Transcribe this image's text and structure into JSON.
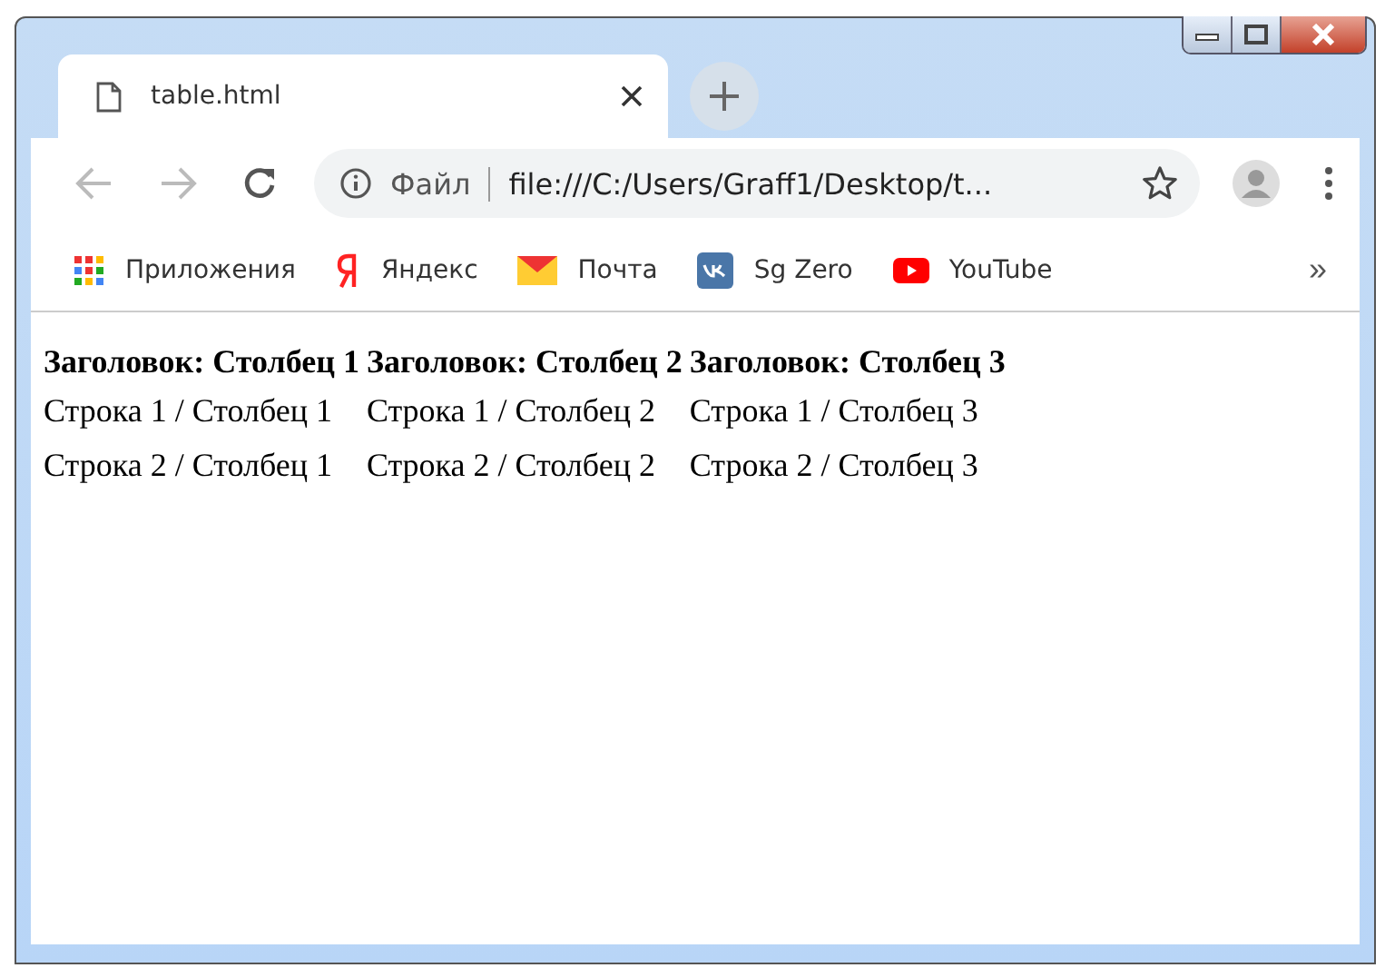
{
  "tab": {
    "title": "table.html",
    "selected": true
  },
  "address_bar": {
    "scheme_label": "Файл",
    "url": "file:///C:/Users/Graff1/Desktop/t..."
  },
  "bookmarks": [
    {
      "label": "Приложения"
    },
    {
      "label": "Яндекс"
    },
    {
      "label": "Почта"
    },
    {
      "label": "Sg Zero"
    },
    {
      "label": "YouTube"
    }
  ],
  "bookmarks_overflow": "»",
  "table": {
    "columns": [
      "Заголовок: Столбец 1",
      "Заголовок: Столбец 2",
      "Заголовок: Столбец 3"
    ],
    "rows": [
      [
        "Строка 1 / Столбец 1",
        "Строка 1 / Столбец 2",
        "Строка 1 / Столбец 3"
      ],
      [
        "Строка 2 / Столбец 1",
        "Строка 2 / Столбец 2",
        "Строка 2 / Столбец 3"
      ]
    ]
  }
}
